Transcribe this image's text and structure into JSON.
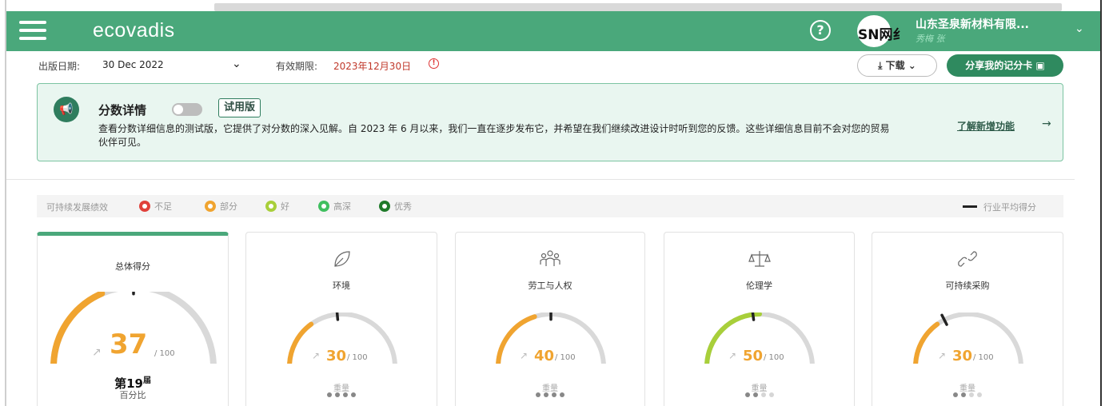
{
  "header": {
    "logo": "ecovadis",
    "avatar_text": "SN网纟",
    "company": "山东圣泉新材料有限...",
    "user": "秀梅 张",
    "help_glyph": "?",
    "brand_color": "#4aa87b"
  },
  "subbar": {
    "publish_label": "出版日期:",
    "publish_date": "30 Dec 2022",
    "valid_label": "有效期限:",
    "valid_date": "2023年12月30日",
    "download_label": "下载",
    "share_label": "分享我的记分卡"
  },
  "banner": {
    "title": "分数详情",
    "badge": "试用版",
    "text": "查看分数详细信息的测试版，它提供了对分数的深入见解。自 2023 年 6 月以来，我们一直在逐步发布它，并希望在我们继续改进设计时听到您的反馈。这些详细信息目前不会对您的贸易伙伴可见。",
    "link": "了解新增功能",
    "toggle_on": false
  },
  "legend": {
    "title": "可持续发展绩效",
    "items": [
      {
        "label": "不足",
        "color": "#e0403a"
      },
      {
        "label": "部分",
        "color": "#f0a430"
      },
      {
        "label": "好",
        "color": "#a8cf3a"
      },
      {
        "label": "高深",
        "color": "#3fbf5f"
      },
      {
        "label": "优秀",
        "color": "#1f7a2a"
      }
    ],
    "avg_label": "行业平均得分"
  },
  "overall": {
    "title": "总体得分",
    "score": "37",
    "total": "/ 100",
    "rank": "第19",
    "rank_suffix": "届",
    "rank_sub": "百分比",
    "score_value": 37,
    "avg_value": 50,
    "color": "#f0a430"
  },
  "categories": [
    {
      "title": "环境",
      "score": "30",
      "total": "/ 100",
      "weight_label": "重量",
      "score_value": 30,
      "avg_value": 47,
      "color": "#f0a430",
      "icon": "leaf-icon",
      "weight": 4
    },
    {
      "title": "劳工与人权",
      "score": "40",
      "total": "/ 100",
      "weight_label": "重量",
      "score_value": 40,
      "avg_value": 50,
      "color": "#f0a430",
      "icon": "people-icon",
      "weight": 4
    },
    {
      "title": "伦理学",
      "score": "50",
      "total": "/ 100",
      "weight_label": "重量",
      "score_value": 50,
      "avg_value": 46,
      "color": "#a8cf3a",
      "icon": "scales-icon",
      "weight": 2
    },
    {
      "title": "可持续采购",
      "score": "30",
      "total": "/ 100",
      "weight_label": "重量",
      "score_value": 30,
      "avg_value": 35,
      "color": "#f0a430",
      "icon": "chain-link-icon",
      "weight": 2
    }
  ]
}
